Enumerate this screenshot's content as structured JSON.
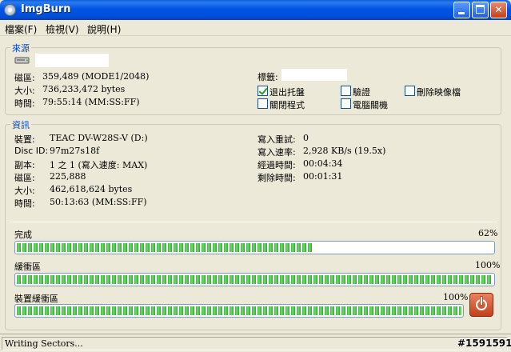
{
  "window": {
    "title": "ImgBurn"
  },
  "menu": [
    "檔案(F)",
    "檢視(V)",
    "說明(H)"
  ],
  "source": {
    "title": "來源",
    "drive_value": "",
    "sectors_label": "磁區:",
    "sectors_value": "359,489 (MODE1/2048)",
    "size_label": "大小:",
    "size_value": "736,233,472 bytes",
    "time_label": "時間:",
    "time_value": "79:55:14 (MM:SS:FF)",
    "volume_label": "標籤:",
    "volume_value": "",
    "options": [
      {
        "label": "退出托盤",
        "checked": true
      },
      {
        "label": "驗證",
        "checked": false
      },
      {
        "label": "刪除映像檔",
        "checked": false
      },
      {
        "label": "關閉程式",
        "checked": false
      },
      {
        "label": "電腦關機",
        "checked": false
      }
    ]
  },
  "info": {
    "title": "資訊",
    "left": [
      {
        "label": "裝置:",
        "value": "TEAC DV-W28S-V (D:)"
      },
      {
        "label": "Disc ID:",
        "value": "97m27s18f"
      },
      {
        "label": "副本:",
        "value": "1 之 1 (寫入速度: MAX)"
      },
      {
        "label": "磁區:",
        "value": "225,888"
      },
      {
        "label": "大小:",
        "value": "462,618,624 bytes"
      },
      {
        "label": "時間:",
        "value": "50:13:63 (MM:SS:FF)"
      }
    ],
    "right": [
      {
        "label": "寫入重試:",
        "value": "0"
      },
      {
        "label": "寫入速率:",
        "value": "2,928 KB/s (19.5x)"
      },
      {
        "label": "經過時間:",
        "value": "00:04:34"
      },
      {
        "label": "剩除時間:",
        "value": "00:01:31"
      }
    ]
  },
  "progress": [
    {
      "label": "完成",
      "percent_text": "62%",
      "fraction": 0.62
    },
    {
      "label": "緩衝區",
      "percent_text": "100%",
      "fraction": 1.0
    },
    {
      "label": "裝置緩衝區",
      "percent_text": "100%",
      "fraction": 1.0
    }
  ],
  "status": {
    "text": "Writing Sectors..."
  },
  "watermark": "#1591591",
  "colors": {
    "group_title": "#0046d5",
    "progress_green": "#3cb83c",
    "abort_red": "#c4401c"
  },
  "icons": {
    "app": "disc-icon",
    "drive": "drive-icon",
    "abort": "power-icon"
  }
}
